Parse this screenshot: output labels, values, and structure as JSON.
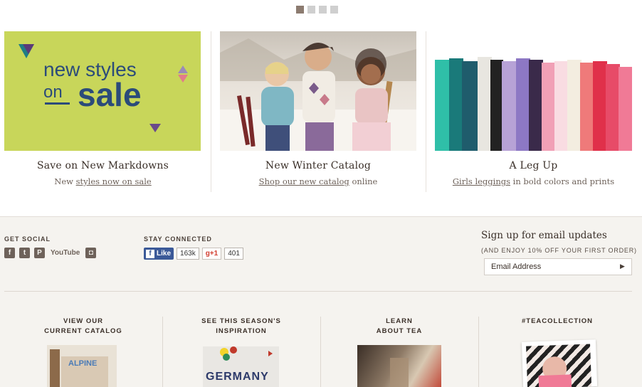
{
  "carousel": {
    "dot_count": 4,
    "active_index": 0
  },
  "promos": [
    {
      "image_text": [
        "new styles",
        "on",
        "sale"
      ],
      "title": "Save on New Markdowns",
      "sub_pre": "New ",
      "sub_link": "styles now on sale",
      "sub_post": ""
    },
    {
      "title": "New Winter Catalog",
      "sub_pre": "",
      "sub_link": "Shop our new catalog",
      "sub_post": " online"
    },
    {
      "title": "A Leg Up",
      "sub_pre": "",
      "sub_link": "Girls leggings",
      "sub_post": " in bold colors and prints"
    }
  ],
  "footer": {
    "get_social": "GET SOCIAL",
    "social_icons": [
      {
        "name": "facebook-icon",
        "glyph": "f"
      },
      {
        "name": "twitter-icon",
        "glyph": "t"
      },
      {
        "name": "pinterest-icon",
        "glyph": "P"
      },
      {
        "name": "youtube-icon",
        "glyph": "YouTube"
      },
      {
        "name": "instagram-icon",
        "glyph": "◘"
      }
    ],
    "stay_connected": "STAY CONNECTED",
    "fb_like": "Like",
    "fb_count": "163k",
    "gplus_label": "g+1",
    "gplus_count": "401",
    "signup_title": "Sign up for email updates",
    "signup_sub": "(AND ENJOY 10% OFF YOUR FIRST ORDER)",
    "email_placeholder": "Email Address",
    "columns": [
      {
        "line1": "VIEW OUR",
        "line2": "CURRENT CATALOG",
        "thumb_text": "ALPINE"
      },
      {
        "line1": "SEE THIS SEASON'S",
        "line2": "INSPIRATION",
        "thumb_text": "GERMANY"
      },
      {
        "line1": "LEARN",
        "line2": "ABOUT TEA",
        "thumb_text": ""
      },
      {
        "line1": "#TEACOLLECTION",
        "line2": "",
        "thumb_text": ""
      }
    ]
  },
  "colors": {
    "sale_bg": "#c8d65a",
    "sale_text": "#2b4b7a",
    "footer_bg": "#f5f3ef",
    "fb_blue": "#3b5998"
  }
}
